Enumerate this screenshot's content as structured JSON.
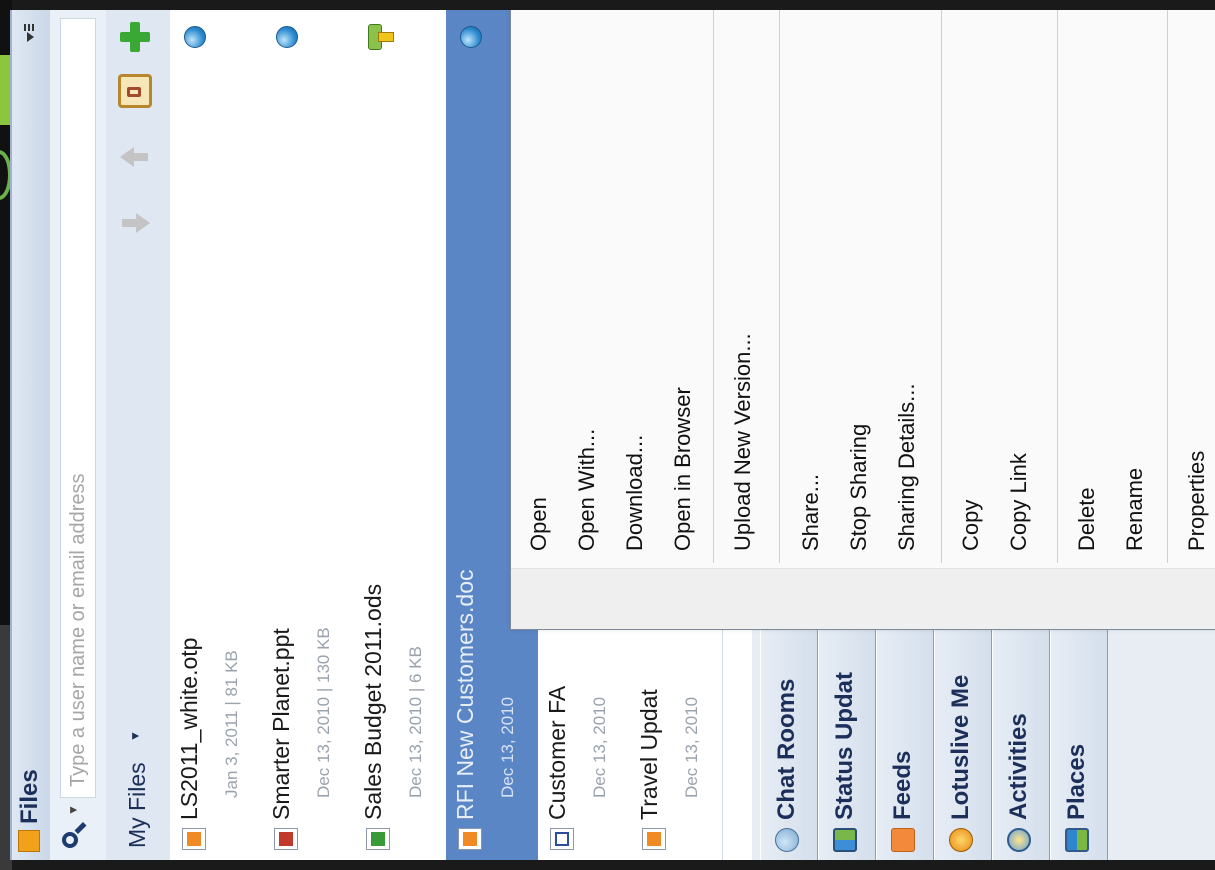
{
  "files_panel": {
    "title": "Files",
    "search_placeholder": "Type a user name or email address",
    "filter_label": "My Files",
    "files": [
      {
        "name": "LS2011_white.otp",
        "meta": "Jan 3, 2011  |  81 KB",
        "type_icon": "document-icon",
        "share_icon": "globe-icon",
        "selected": false
      },
      {
        "name": "Smarter Planet.ppt",
        "meta": "Dec 13, 2010  |  130 KB",
        "type_icon": "presentation-icon",
        "share_icon": "globe-icon",
        "selected": false
      },
      {
        "name": "Sales Budget 2011.ods",
        "meta": "Dec 13, 2010  |  6 KB",
        "type_icon": "spreadsheet-icon",
        "share_icon": "group-share-icon",
        "selected": false
      },
      {
        "name": "RFI New Customers.doc",
        "meta": "Dec 13, 2010",
        "type_icon": "document-icon",
        "share_icon": "globe-icon",
        "selected": true
      },
      {
        "name": "Customer FA",
        "meta": "Dec 13, 2010",
        "type_icon": "text-document-icon",
        "share_icon": "globe-icon",
        "selected": false
      },
      {
        "name": "Travel Updat",
        "meta": "Dec 13, 2010",
        "type_icon": "document-icon",
        "share_icon": "globe-icon",
        "selected": false
      }
    ]
  },
  "sidebars": [
    {
      "label": "Chat Rooms",
      "icon": "chat-rooms-icon"
    },
    {
      "label": "Status Updat",
      "icon": "status-updates-icon"
    },
    {
      "label": "Feeds",
      "icon": "feeds-icon"
    },
    {
      "label": "Lotuslive Me",
      "icon": "lotuslive-icon"
    },
    {
      "label": "Activities",
      "icon": "activities-icon"
    },
    {
      "label": "Places",
      "icon": "places-icon"
    }
  ],
  "context_menu": {
    "items": [
      "Open",
      "Open With...",
      "Download...",
      "Open in Browser",
      "Upload New Version...",
      "Share...",
      "Stop Sharing",
      "Sharing Details...",
      "Copy",
      "Copy Link",
      "Delete",
      "Rename",
      "Properties"
    ]
  },
  "colors": {
    "selection": "#5a86c6",
    "header_text": "#1c2e5a",
    "background": "#1a1a1a"
  }
}
